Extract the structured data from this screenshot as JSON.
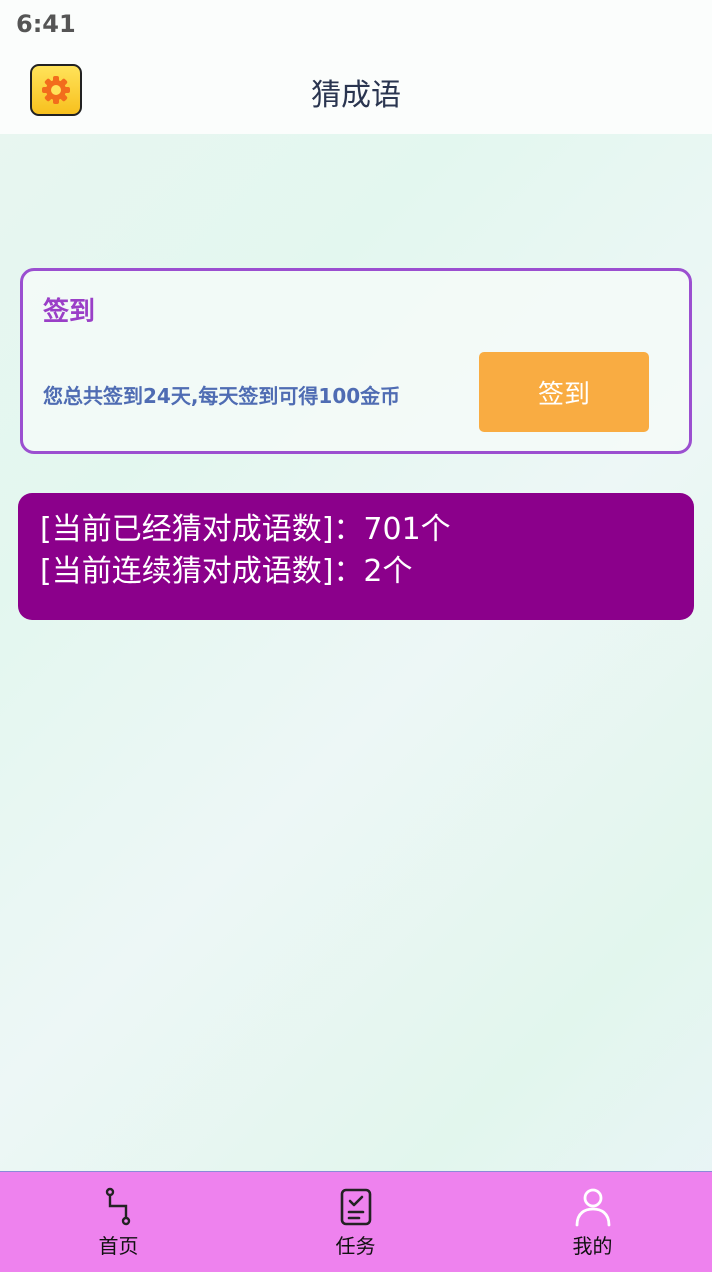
{
  "status_bar": {
    "time": "6:41"
  },
  "header": {
    "title": "猜成语",
    "settings_icon": "gear-icon"
  },
  "checkin": {
    "title": "签到",
    "description": "您总共签到24天,每天签到可得100金币",
    "button_label": "签到"
  },
  "stats": {
    "guessed_line": "[当前已经猜对成语数]：701个",
    "streak_line": "[当前连续猜对成语数]：2个"
  },
  "tabs": [
    {
      "label": "首页",
      "icon": "route-icon"
    },
    {
      "label": "任务",
      "icon": "task-list-icon"
    },
    {
      "label": "我的",
      "icon": "user-icon"
    }
  ],
  "colors": {
    "card_border": "#9b4fd0",
    "checkin_button": "#f9ac42",
    "stats_background": "#8b008b",
    "tab_bar": "#ee82ee"
  }
}
